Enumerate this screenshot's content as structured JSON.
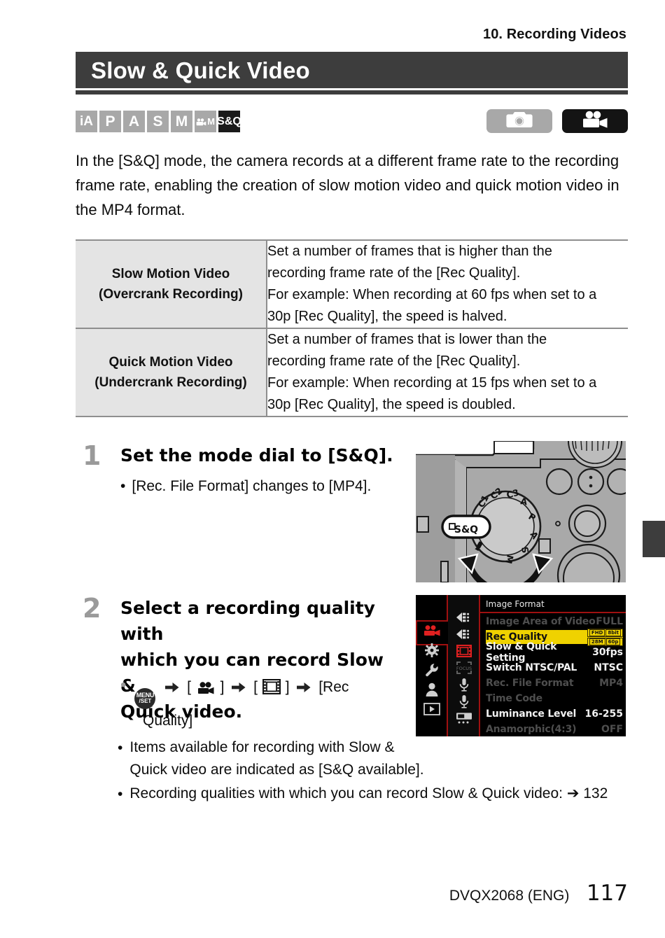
{
  "running_head": "10. Recording Videos",
  "title": "Slow & Quick Video",
  "mode_badges": [
    {
      "label": "iA",
      "active": false
    },
    {
      "label": "P",
      "active": false
    },
    {
      "label": "A",
      "active": false
    },
    {
      "label": "S",
      "active": false
    },
    {
      "label": "M",
      "active": false
    },
    {
      "label": "M",
      "icon": "video-camera-icon",
      "active": false
    },
    {
      "label": "S&Q",
      "active": true
    }
  ],
  "mode_pills": [
    {
      "icon": "photo-camera-icon",
      "active": false
    },
    {
      "icon": "video-camera-icon",
      "active": true
    }
  ],
  "intro": "In the [S&Q] mode, the camera records at a different frame rate to the recording frame rate, enabling the creation of slow motion video and quick motion video in the MP4 format.",
  "table": {
    "rows": [
      {
        "label_line1": "Slow Motion Video",
        "label_line2": "(Overcrank Recording)",
        "body_lines": [
          "Set a number of frames that is higher than the",
          "recording frame rate of the [Rec Quality].",
          "For example: When recording at 60 fps when set to a",
          "30p [Rec Quality], the speed is halved."
        ]
      },
      {
        "label_line1": "Quick Motion Video",
        "label_line2": "(Undercrank Recording)",
        "body_lines": [
          "Set a number of frames that is lower than the",
          "recording frame rate of the [Rec Quality].",
          "For example: When recording at 15 fps when set to a",
          "30p [Rec Quality], the speed is doubled."
        ]
      }
    ]
  },
  "steps": [
    {
      "number": "1",
      "heading": "Set the mode dial to [S&Q].",
      "bullet": "[Rec. File Format] changes to [MP4]."
    },
    {
      "number": "2",
      "heading_line1": "Select a recording quality with",
      "heading_line2": "which you can record Slow &",
      "heading_line3": "Quick video.",
      "path_menu": "MENU",
      "path_set": "/SET",
      "path_tail1": "[",
      "path_tail2": "]",
      "path_rec": "[Rec",
      "path_quality": "Quality]"
    }
  ],
  "notes": [
    {
      "line1": "Items available for recording with Slow &",
      "line2": "Quick video are indicated as [S&Q available]."
    },
    {
      "line1": "Recording qualities with which you can record Slow & Quick video: ➔ 132"
    }
  ],
  "figures": {
    "dial": {
      "name": "mode-dial-photo",
      "callout": "S&Q",
      "dial_labels": [
        "C1",
        "C2",
        "C3",
        "A",
        "P",
        "A",
        "S",
        "M"
      ]
    },
    "menu": {
      "name": "camera-menu-screenshot",
      "title": "Image Format",
      "items": [
        {
          "label": "Image Area of Video",
          "value": "FULL",
          "state": "dim"
        },
        {
          "label": "Rec Quality",
          "value": "",
          "state": "selected",
          "badge": [
            "FHD",
            "8bit",
            "28M",
            "60p"
          ]
        },
        {
          "label": "Slow & Quick Setting",
          "value": "30fps",
          "state": "normal"
        },
        {
          "label": "Switch NTSC/PAL",
          "value": "NTSC",
          "state": "normal"
        },
        {
          "label": "Rec. File Format",
          "value": "MP4",
          "state": "dim"
        },
        {
          "label": "Time Code",
          "value": "",
          "state": "dim"
        },
        {
          "label": "Luminance Level",
          "value": "16-255",
          "state": "normal"
        },
        {
          "label": "Anamorphic(4:3)",
          "value": "OFF",
          "state": "dim"
        }
      ],
      "tab_icons": [
        "video-camera-icon",
        "gear-icon",
        "wrench-icon",
        "person-icon",
        "playback-icon"
      ],
      "sub_icons": [
        "image-quality-icon",
        "image-quality-icon",
        "film-format-icon",
        "focus-icon",
        "mic-icon",
        "mic-icon",
        "monitor-icon"
      ]
    }
  },
  "footer": {
    "doc_id": "DVQX2068 (ENG)",
    "page_number": "117"
  },
  "colors": {
    "title_bar": "#3d3d3d",
    "badge_inactive": "#a8a8a8",
    "badge_active": "#1a1a1a",
    "table_label_bg": "#e4e4e4",
    "menu_highlight": "#efd200",
    "menu_accent": "#a01010",
    "step_number": "#9a9a9a"
  }
}
